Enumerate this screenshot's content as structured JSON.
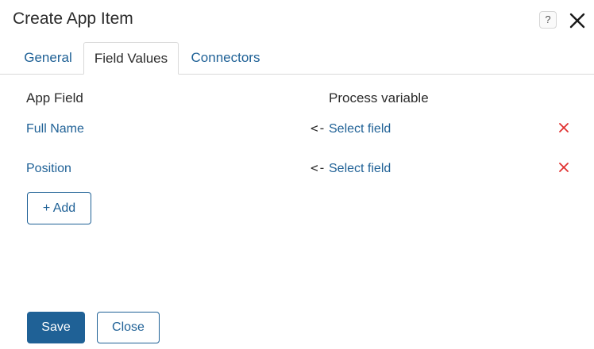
{
  "dialog": {
    "title": "Create App Item",
    "help_glyph": "?",
    "close_icon": "close-icon"
  },
  "tabs": [
    {
      "label": "General",
      "active": false
    },
    {
      "label": "Field Values",
      "active": true
    },
    {
      "label": "Connectors",
      "active": false
    }
  ],
  "table": {
    "headers": {
      "app_field": "App Field",
      "process_variable": "Process variable"
    },
    "rows": [
      {
        "app_field": "Full Name",
        "arrow": "<-",
        "process_variable": "Select field"
      },
      {
        "app_field": "Position",
        "arrow": "<-",
        "process_variable": "Select field"
      }
    ]
  },
  "actions": {
    "add_label": "+ Add",
    "save_label": "Save",
    "close_label": "Close"
  },
  "colors": {
    "accent": "#1f6196",
    "remove": "#e0302f",
    "text": "#2b2b2b",
    "border": "#d9d9d9"
  }
}
